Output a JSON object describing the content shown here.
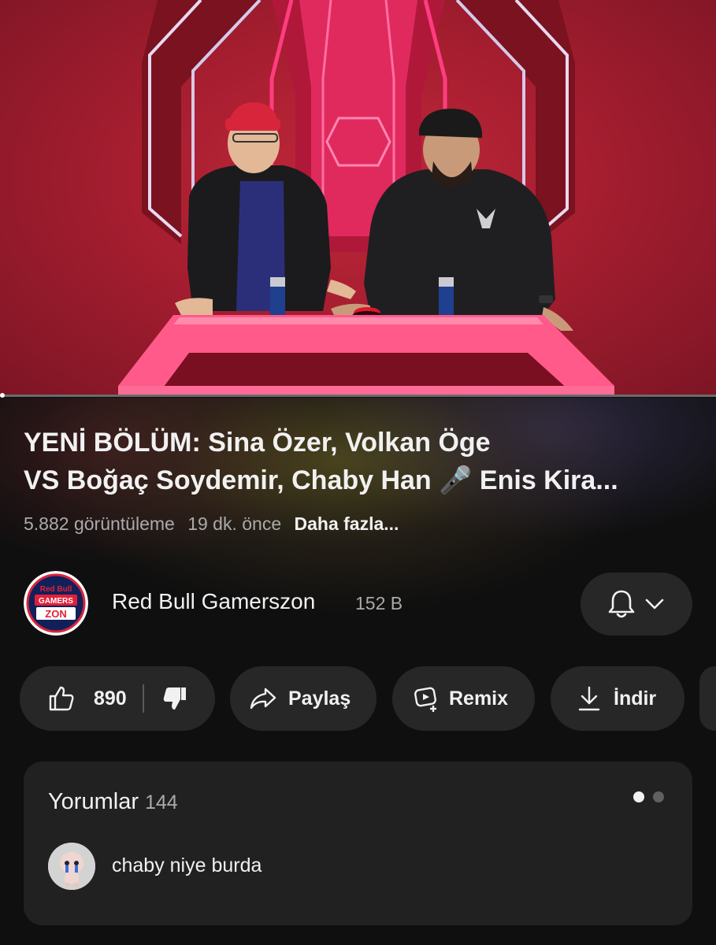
{
  "video": {
    "progress_percent": 0.5
  },
  "details": {
    "title_line1": "YENİ BÖLÜM: Sina Özer, Volkan Öge",
    "title_line2": "VS Boğaç Soydemir, Chaby Han 🎤 Enis Kira...",
    "views": "5.882 görüntüleme",
    "time_ago": "19 dk. önce",
    "more_label": "Daha fazla..."
  },
  "channel": {
    "name": "Red Bull Gamerszon",
    "subscribers": "152 B",
    "logo_text_top": "Red Bull",
    "logo_text_mid": "GAMERS",
    "logo_text_bottom": "ZON",
    "bell_icon": "bell-icon",
    "chevron_icon": "chevron-down-icon"
  },
  "actions": {
    "like_count": "890",
    "share_label": "Paylaş",
    "remix_label": "Remix",
    "download_label": "İndir"
  },
  "comments": {
    "title": "Yorumlar",
    "count": "144",
    "first_comment": "chaby niye burda"
  },
  "colors": {
    "background": "#0f0f0f",
    "chip": "#272727",
    "comments_panel": "#212121",
    "accent_red": "#c0273a",
    "neon_pink": "#ff3d7f"
  }
}
